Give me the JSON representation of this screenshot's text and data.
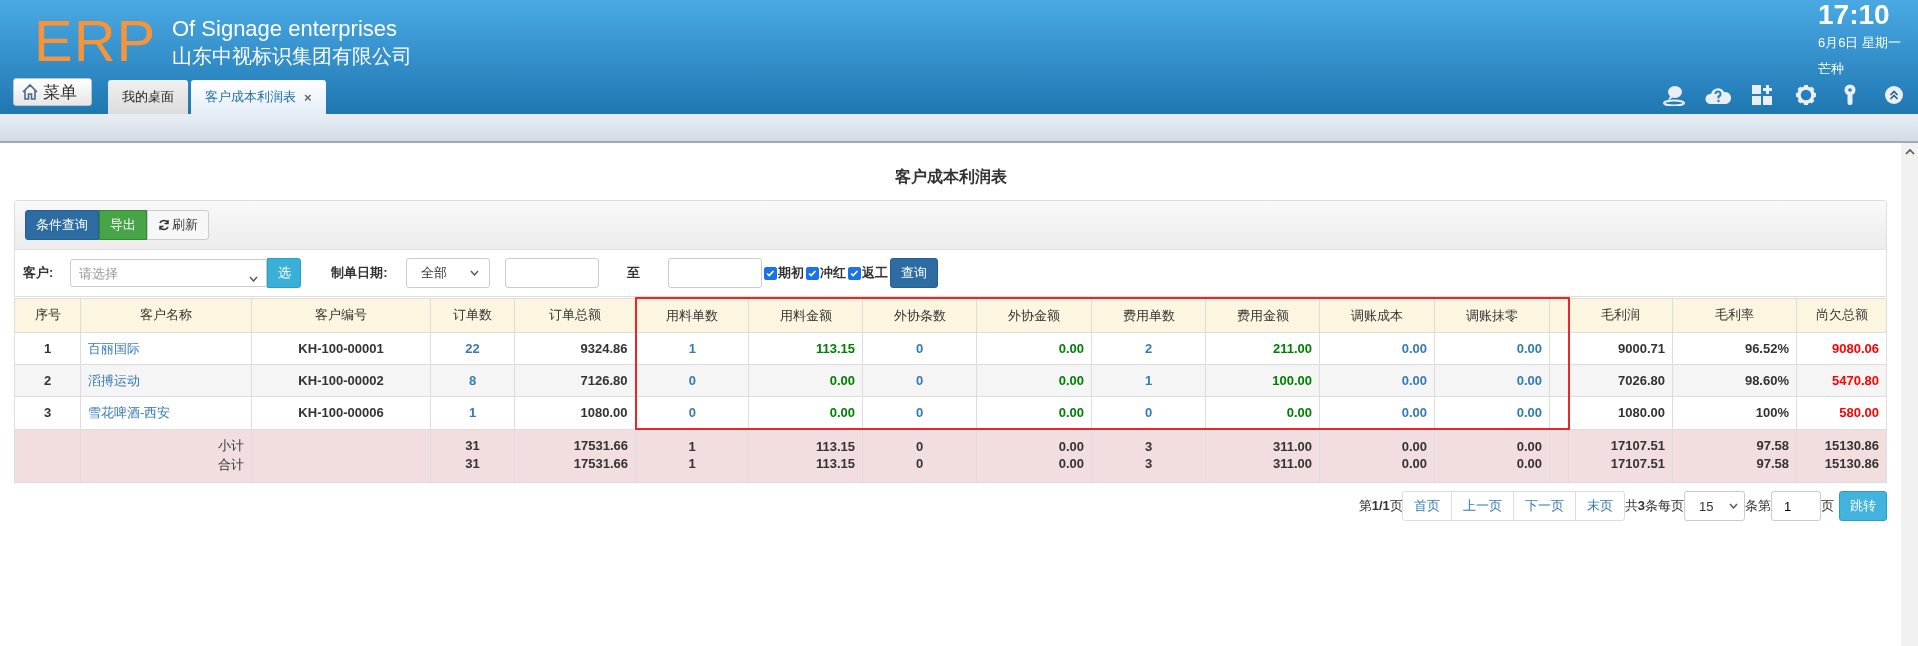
{
  "header": {
    "logo": "ERP",
    "title": "Of Signage enterprises",
    "subtitle": "山东中视标识集团有限公司",
    "menu_button": "菜单",
    "clock": {
      "time": "17:10",
      "date": "6月6日 星期一",
      "solar_term": "芒种"
    }
  },
  "tabs": [
    {
      "label": "我的桌面",
      "selected": false
    },
    {
      "label": "客户成本利润表",
      "selected": true,
      "close": "×"
    }
  ],
  "page_title": "客户成本利润表",
  "toolbar": [
    {
      "label": "条件查询",
      "kind": "primary"
    },
    {
      "label": "导出",
      "kind": "success"
    },
    {
      "label": "刷新",
      "kind": "refresh"
    }
  ],
  "filters": {
    "customer_label": "客户:",
    "customer_placeholder": "请选择",
    "pick_button": "选",
    "date_label": "制单日期:",
    "date_range": "全部",
    "to_label": "至",
    "options": [
      {
        "label": "期初",
        "checked": true
      },
      {
        "label": "冲红",
        "checked": true
      },
      {
        "label": "返工",
        "checked": true
      }
    ],
    "query_button": "查询"
  },
  "table": {
    "columns": [
      {
        "label": "序号",
        "kind": "index",
        "highlighted": false
      },
      {
        "label": "客户名称",
        "kind": "name",
        "highlighted": false
      },
      {
        "label": "客户编号",
        "kind": "code",
        "highlighted": false
      },
      {
        "label": "订单数",
        "kind": "count",
        "highlighted": false
      },
      {
        "label": "订单总额",
        "kind": "total",
        "highlighted": false
      },
      {
        "label": "用料单数",
        "kind": "count",
        "highlighted": true
      },
      {
        "label": "用料金额",
        "kind": "money",
        "highlighted": true
      },
      {
        "label": "外协条数",
        "kind": "count",
        "highlighted": true
      },
      {
        "label": "外协金额",
        "kind": "money",
        "highlighted": true
      },
      {
        "label": "费用单数",
        "kind": "count",
        "highlighted": true
      },
      {
        "label": "费用金额",
        "kind": "money",
        "highlighted": true
      },
      {
        "label": "调账成本",
        "kind": "adjust",
        "highlighted": true
      },
      {
        "label": "调账抹零",
        "kind": "adjust",
        "highlighted": true
      },
      {
        "kind": "spacer",
        "highlighted": true
      },
      {
        "label": "毛利润",
        "kind": "total",
        "highlighted": false
      },
      {
        "label": "毛利率",
        "kind": "total",
        "highlighted": false
      },
      {
        "label": "尚欠总额",
        "kind": "debt",
        "highlighted": false
      }
    ],
    "rows": [
      [
        "1",
        "百丽国际",
        "KH-100-00001",
        "22",
        "9324.86",
        "1",
        "113.15",
        "0",
        "0.00",
        "2",
        "211.00",
        "0.00",
        "0.00",
        "",
        "9000.71",
        "96.52%",
        "9080.06"
      ],
      [
        "2",
        "滔搏运动",
        "KH-100-00002",
        "8",
        "7126.80",
        "0",
        "0.00",
        "0",
        "0.00",
        "1",
        "100.00",
        "0.00",
        "0.00",
        "",
        "7026.80",
        "98.60%",
        "5470.80"
      ],
      [
        "3",
        "雪花啤酒-西安",
        "KH-100-00006",
        "1",
        "1080.00",
        "0",
        "0.00",
        "0",
        "0.00",
        "0",
        "0.00",
        "0.00",
        "0.00",
        "",
        "1080.00",
        "100%",
        "580.00"
      ]
    ],
    "summary_rows": [
      [
        "",
        "小计",
        "",
        "31",
        "17531.66",
        "1",
        "113.15",
        "0",
        "0.00",
        "3",
        "311.00",
        "0.00",
        "0.00",
        "",
        "17107.51",
        "97.58",
        "15130.86"
      ],
      [
        "",
        "合计",
        "",
        "31",
        "17531.66",
        "1",
        "113.15",
        "0",
        "0.00",
        "3",
        "311.00",
        "0.00",
        "0.00",
        "",
        "17107.51",
        "97.58",
        "15130.86"
      ]
    ]
  },
  "pagination": {
    "page_info": "第**1/1**页",
    "buttons": [
      "首页",
      "上一页",
      "下一页",
      "末页"
    ],
    "total": "共**3**条每页",
    "page_size": "15",
    "page_label": "条第",
    "page_input": "1",
    "page_suffix": "页",
    "jump_button": "跳转"
  }
}
